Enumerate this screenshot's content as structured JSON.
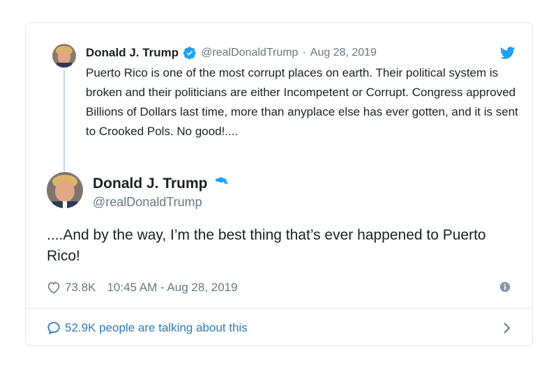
{
  "quoted_tweet": {
    "author_name": "Donald J. Trump",
    "author_handle": "@realDonaldTrump",
    "separator": "·",
    "date": "Aug 28, 2019",
    "text": "Puerto Rico is one of the most corrupt places on earth. Their political system is broken and their politicians are either Incompetent or Corrupt. Congress approved Billions of Dollars last time, more than anyplace else has ever gotten, and it is sent to Crooked Pols. No good!...."
  },
  "main_tweet": {
    "author_name": "Donald J. Trump",
    "author_handle": "@realDonaldTrump",
    "text": "....And by the way, I’m the best thing that’s ever happened to Puerto Rico!",
    "like_count": "73.8K",
    "timestamp": "10:45 AM - Aug 28, 2019"
  },
  "footer": {
    "talking_label": "52.9K people are talking about this"
  },
  "icons": {
    "verified": "verified-badge-icon",
    "bird": "twitter-bird-icon",
    "heart": "heart-icon",
    "info": "info-icon",
    "bubble": "speech-bubble-icon",
    "chevron": "chevron-right-icon"
  },
  "colors": {
    "verified_blue": "#1da1f2",
    "link_blue": "#2b7bb9",
    "muted_gray": "#697882",
    "border": "#e1e8ed"
  }
}
